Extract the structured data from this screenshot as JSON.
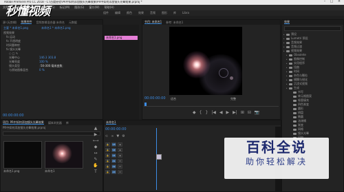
{
  "titlebar": {
    "title": "Adobe Premiere Pro CC 2018 - C:\\百度经验\\PR中如何添加镜头光晕效果\\PR中如何添加镜头光晕效果.prproj *"
  },
  "menu": [
    "文件(F)",
    "编辑(E)",
    "剪辑(C)",
    "序列(S)",
    "标记(M)",
    "图形(G)",
    "窗口(W)",
    "帮助(H)"
  ],
  "workspace": [
    "组件",
    "编辑",
    "颜色",
    "效果",
    "音频",
    "图形",
    "库",
    "Libra"
  ],
  "watermark_top": "秒懂视频",
  "source_panel": {
    "tabs": [
      "源:(无剪辑)",
      "效果控件",
      "音频剪辑混合器:未命名",
      "元数据"
    ],
    "clip": "主要 * 未命名1.png",
    "sequence": "未命名1 * 未命名1.png",
    "rows": [
      {
        "label": "视频效果",
        "value": ""
      },
      {
        "label": "fx 运动",
        "value": ""
      },
      {
        "label": "fx 不透明度",
        "value": ""
      },
      {
        "label": "时间重映射",
        "value": ""
      },
      {
        "label": "fx 镜头光晕",
        "value": ""
      },
      {
        "label": "○ □ ✎",
        "value": ""
      },
      {
        "label": "光晕中心",
        "value": "146.3   303.8"
      },
      {
        "label": "光晕亮度",
        "value": "100 %"
      },
      {
        "label": "镜头类型",
        "value": "50-300 毫米变焦"
      },
      {
        "label": "与原始图像混合",
        "value": "0 %"
      }
    ],
    "timeline_clip": "未命名1.png",
    "timecode": "00:00:00:00"
  },
  "program_panel": {
    "tabs": [
      "节目: 未命名1",
      "参考: 未命名1"
    ],
    "timecode": "00:00:00:00",
    "fit": "适合",
    "quality": "完整",
    "transport": [
      "◆",
      "{",
      "}",
      "|◀",
      "◀",
      "▶",
      "▶|",
      "⊞",
      "⊟",
      "📷"
    ]
  },
  "effects_panel": {
    "tabs": [
      "效果"
    ],
    "items": [
      "预设",
      "Lumetri 预设",
      "音频效果",
      "音频过渡",
      "视频效果",
      "Obsolete",
      "图像控制",
      "实用程序",
      "扭曲",
      "时间",
      "杂色与颗粒",
      "模糊与锐化",
      "沉浸式视频",
      "生成",
      "书写",
      "单元格图案",
      "吸管填充",
      "四色渐变",
      "圆形",
      "棋盘",
      "椭圆",
      "油漆桶",
      "渐变",
      "网格",
      "镜头光晕",
      "闪电",
      "视频",
      "调整",
      "过时"
    ]
  },
  "project_panel": {
    "tabs": [
      "项目: PR中如何添加镜头光晕效果",
      "媒体浏览器",
      "库"
    ],
    "path": "PR中如何添加镜头光晕效果.prproj",
    "items": [
      "未命名1.png",
      "未命名1"
    ]
  },
  "timeline": {
    "tab": "未命名1",
    "timecode": "00:00:00:00",
    "tracks": [
      "V3",
      "V2",
      "V1",
      "A1",
      "A2",
      "A3"
    ]
  },
  "watermark_br": {
    "big": "百科全说",
    "small": "助你轻松解决"
  },
  "colors": {
    "accent": "#3d8ee8",
    "clip": "#e57ed6"
  }
}
